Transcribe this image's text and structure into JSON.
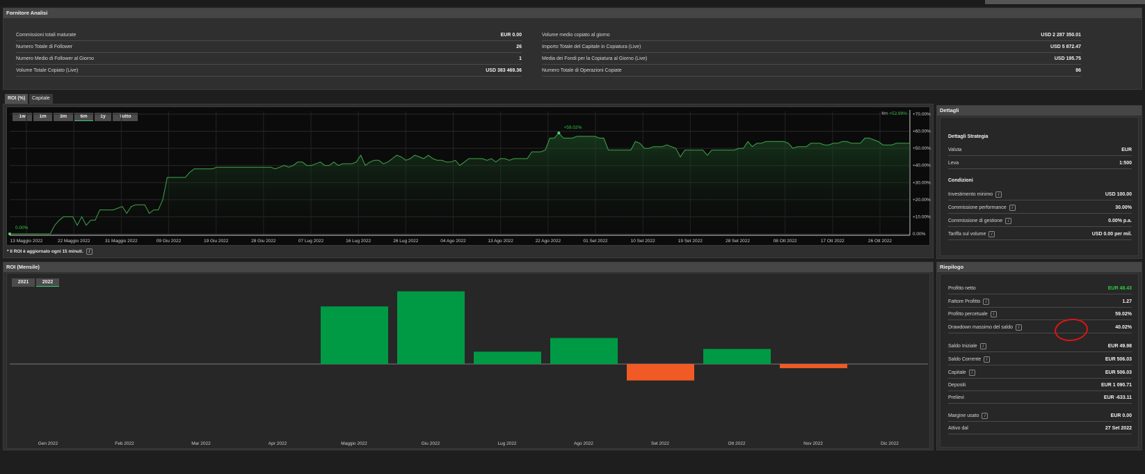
{
  "supplier": {
    "title": "Fornitore Analisi",
    "left": [
      {
        "label": "Commissioni totali maturate",
        "value": "EUR 0.00"
      },
      {
        "label": "Numero Totale di Follower",
        "value": "26"
      },
      {
        "label": "Numero Medio di Follower al Giorno",
        "value": "1"
      },
      {
        "label": "Volume Totale Copiato (Live)",
        "value": "USD 383 469.36"
      }
    ],
    "right": [
      {
        "label": "Volume medio copiato al giorno",
        "value": "USD 2 287 350.01"
      },
      {
        "label": "Importo Totale del Capitale in Copiatura (Live)",
        "value": "USD 5 872.47"
      },
      {
        "label": "Media dei Fondi per la Copiatura al Giorno (Live)",
        "value": "USD 195.75"
      },
      {
        "label": "Numero Totale di Operazioni Copiate",
        "value": "86"
      }
    ]
  },
  "roi_tabs": [
    "ROI (%)",
    "Capitale"
  ],
  "range_buttons": [
    "1w",
    "1m",
    "3m",
    "6m",
    "1y",
    "Tutto"
  ],
  "range_active": "6m",
  "roi_legend": {
    "period": "6m",
    "value": "+52.98%"
  },
  "roi_footnote": "* Il ROI è aggiornato ogni 15 minuti.",
  "roi_peak_label": "+59.02%",
  "roi_start_label": "0.00%",
  "chart_data": [
    {
      "type": "area",
      "x_tick_labels": [
        "13 Maggio 2022",
        "22 Maggio 2022",
        "31 Maggio 2022",
        "09 Giu 2022",
        "19 Giu 2022",
        "28 Giu 2022",
        "07 Lug 2022",
        "16 Lug 2022",
        "26 Lug 2022",
        "04 Ago 2022",
        "13 Ago 2022",
        "22 Ago 2022",
        "01 Set 2022",
        "10 Set 2022",
        "19 Set 2022",
        "28 Set 2022",
        "08 Ott 2022",
        "17 Ott 2022",
        "26 Ott 2022"
      ],
      "y_tick_labels": [
        "0.00%",
        "+10.00%",
        "+20.00%",
        "+30.00%",
        "+40.00%",
        "+50.00%",
        "+60.00%",
        "+70.00%"
      ],
      "ylim": [
        0,
        70
      ],
      "series": [
        {
          "values": [
            0,
            0,
            0,
            0,
            0,
            0,
            0,
            0,
            0,
            0,
            5,
            8,
            10,
            10,
            10,
            5,
            10,
            5,
            8,
            8,
            14,
            14,
            14,
            14,
            15,
            16,
            12,
            16,
            17,
            17,
            17,
            12,
            14,
            14,
            20,
            33,
            33,
            33,
            33,
            33,
            36,
            38,
            38,
            38,
            38,
            38,
            39,
            39,
            39,
            39,
            39,
            39,
            39,
            39,
            39,
            39,
            39,
            39,
            39,
            38,
            39,
            40,
            39,
            40,
            42,
            42,
            40,
            40,
            41,
            42,
            40,
            40,
            42,
            40,
            41,
            41,
            41,
            42,
            46,
            40,
            42,
            43,
            43,
            41,
            42,
            44,
            46,
            45,
            43,
            44,
            46,
            45,
            44,
            46,
            44,
            43,
            43,
            42,
            42,
            43,
            40,
            42,
            44,
            44,
            44,
            44,
            43,
            44,
            42,
            44,
            44,
            43,
            44,
            44,
            44,
            44,
            48,
            48,
            48,
            49,
            56,
            56,
            59.02,
            56,
            56,
            56,
            57,
            57,
            57,
            57,
            57,
            56,
            56,
            49,
            49,
            49,
            49,
            49,
            49,
            54,
            53,
            50,
            50,
            51,
            51,
            51,
            52,
            51,
            50,
            45,
            49,
            49,
            49,
            49,
            49,
            46,
            49,
            49,
            49,
            49,
            49,
            49,
            50,
            50,
            54,
            51,
            53,
            53,
            54,
            54,
            54,
            54,
            54,
            53,
            50,
            51,
            51,
            51,
            53,
            53,
            53,
            52,
            52,
            53,
            53,
            54,
            54,
            53,
            53,
            53,
            56,
            56,
            55,
            54,
            52,
            52,
            52,
            53,
            53,
            53,
            52.98
          ]
        }
      ]
    },
    {
      "type": "bar",
      "title": "ROI (Mensile)",
      "categories": [
        "Gen 2022",
        "Feb 2022",
        "Mar 2022",
        "Apr 2022",
        "Maggio 2022",
        "Giu 2022",
        "Lug 2022",
        "Ago 2022",
        "Set 2022",
        "Ott 2022",
        "Nov 2022",
        "Dic 2022"
      ],
      "values": [
        0,
        0,
        0,
        0,
        42,
        53,
        9,
        19,
        -12,
        11,
        -3,
        0
      ],
      "colors": {
        "positive": "#009a44",
        "negative": "#f15a24"
      }
    }
  ],
  "monthly": {
    "title": "ROI (Mensile)",
    "years": [
      "2021",
      "2022"
    ],
    "year_active": "2022"
  },
  "details": {
    "title": "Dettagli",
    "strategy_title": "Dettagli Strategia",
    "strategy": [
      {
        "label": "Valuta",
        "value": "EUR"
      },
      {
        "label": "Leva",
        "value": "1:500"
      }
    ],
    "conditions_title": "Condizioni",
    "conditions": [
      {
        "label": "Investimento minimo",
        "value": "USD 100.00",
        "info": true
      },
      {
        "label": "Commissione performance",
        "value": "30.00%",
        "info": true
      },
      {
        "label": "Commissione di gestione",
        "value": "0.00% p.a.",
        "info": true
      },
      {
        "label": "Tariffa sul volume",
        "value": "USD 0.00 per mil.",
        "info": true
      }
    ]
  },
  "summary": {
    "title": "Riepilogo",
    "rows": [
      {
        "label": "Profitto netto",
        "value": "EUR 48.43",
        "info": false,
        "green": true
      },
      {
        "label": "Fattore Profitto",
        "value": "1.27",
        "info": true
      },
      {
        "label": "Profitto percetuale",
        "value": "59.02%",
        "info": true
      },
      {
        "label": "Drawdown massimo del saldo",
        "value": "40.02%",
        "info": true
      },
      {
        "label": "Saldo Iniziale",
        "value": "EUR 49.98",
        "info": true
      },
      {
        "label": "Saldo Corrente",
        "value": "EUR 506.03",
        "info": true
      },
      {
        "label": "Capitale",
        "value": "EUR 506.03",
        "info": true
      },
      {
        "label": "Depositi",
        "value": "EUR 1 090.71",
        "info": false
      },
      {
        "label": "Prelievi",
        "value": "EUR -633.11",
        "info": false
      },
      {
        "label": "Margine usato",
        "value": "EUR 0.00",
        "info": true
      },
      {
        "label": "Attivo dal",
        "value": "27 Set 2022",
        "info": false
      }
    ]
  },
  "colors": {
    "accent_green": "#2ecc40",
    "bar_green": "#009a44",
    "bar_orange": "#f15a24",
    "annotation_red": "#e01414"
  }
}
